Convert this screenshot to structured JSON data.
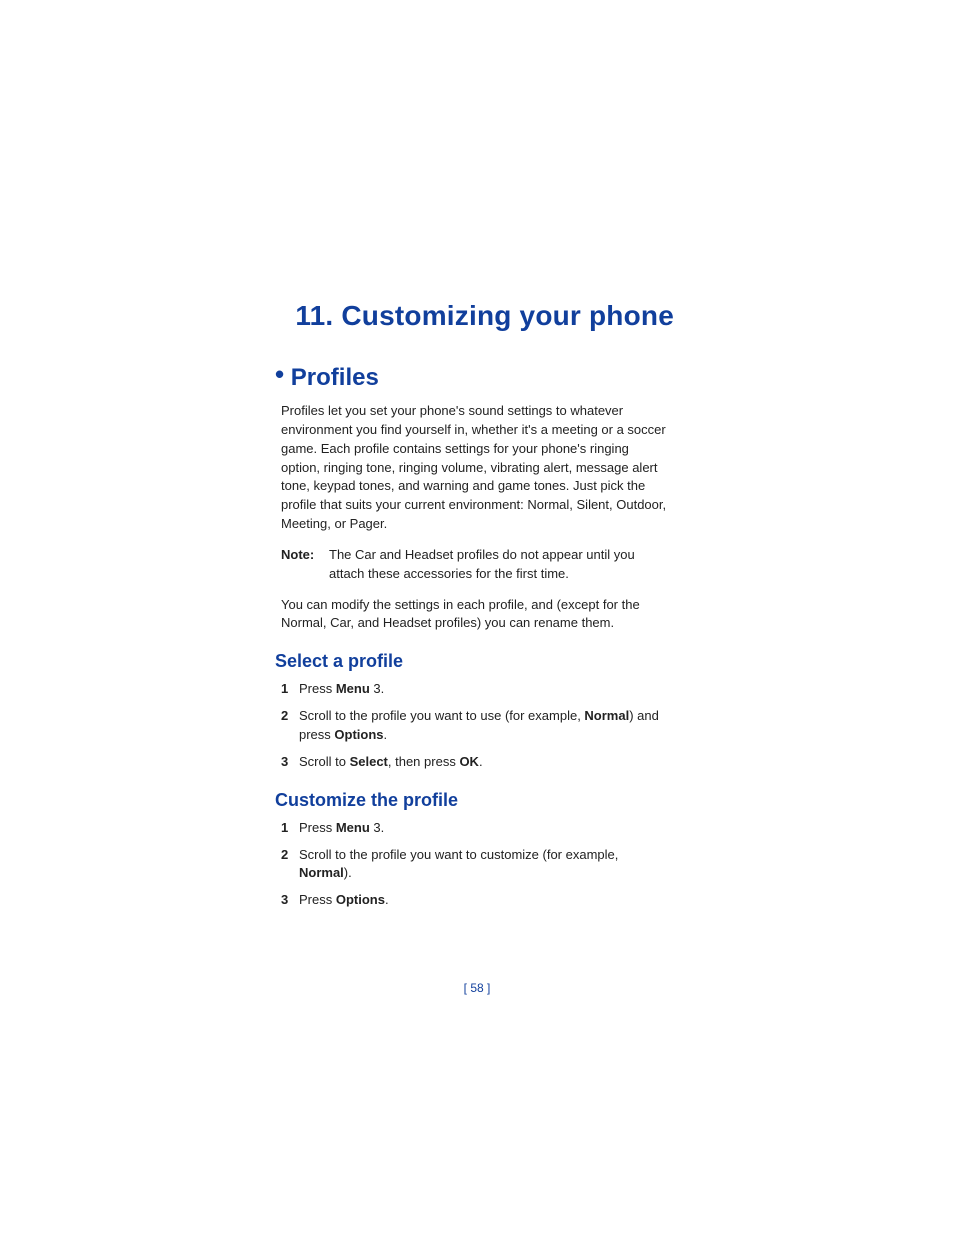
{
  "chapter": {
    "title": "11. Customizing your phone"
  },
  "section": {
    "bullet": "•",
    "title": "Profiles",
    "intro": "Profiles let you set your phone's sound settings to whatever environment you find yourself in, whether it's a meeting or a soccer game. Each profile contains settings for your phone's ringing option, ringing tone, ringing volume, vibrating alert, message alert tone, keypad tones, and warning and game tones. Just pick the profile that suits your current environment: Normal, Silent, Outdoor, Meeting, or Pager.",
    "note": {
      "label": "Note:",
      "text": "The Car and Headset profiles do not appear until you attach these accessories for the first time."
    },
    "after_note": "You can modify the settings in each profile, and (except for the Normal, Car, and Headset profiles) you can rename them."
  },
  "select_profile": {
    "title": "Select a profile",
    "steps": [
      {
        "n": "1",
        "t1": "Press ",
        "b1": "Menu",
        "t2": " 3."
      },
      {
        "n": "2",
        "t1": "Scroll to the profile you want to use (for example, ",
        "b1": "Normal",
        "t2": ") and press ",
        "b2": "Options",
        "t3": "."
      },
      {
        "n": "3",
        "t1": "Scroll to ",
        "b1": "Select",
        "t2": ", then press ",
        "b2": "OK",
        "t3": "."
      }
    ]
  },
  "customize_profile": {
    "title": "Customize the profile",
    "steps": [
      {
        "n": "1",
        "t1": "Press ",
        "b1": "Menu",
        "t2": " 3."
      },
      {
        "n": "2",
        "t1": "Scroll to the profile you want to customize (for example, ",
        "b1": "Normal",
        "t2": ")."
      },
      {
        "n": "3",
        "t1": "Press ",
        "b1": "Options",
        "t2": "."
      }
    ]
  },
  "footer": {
    "page": "[ 58 ]"
  }
}
